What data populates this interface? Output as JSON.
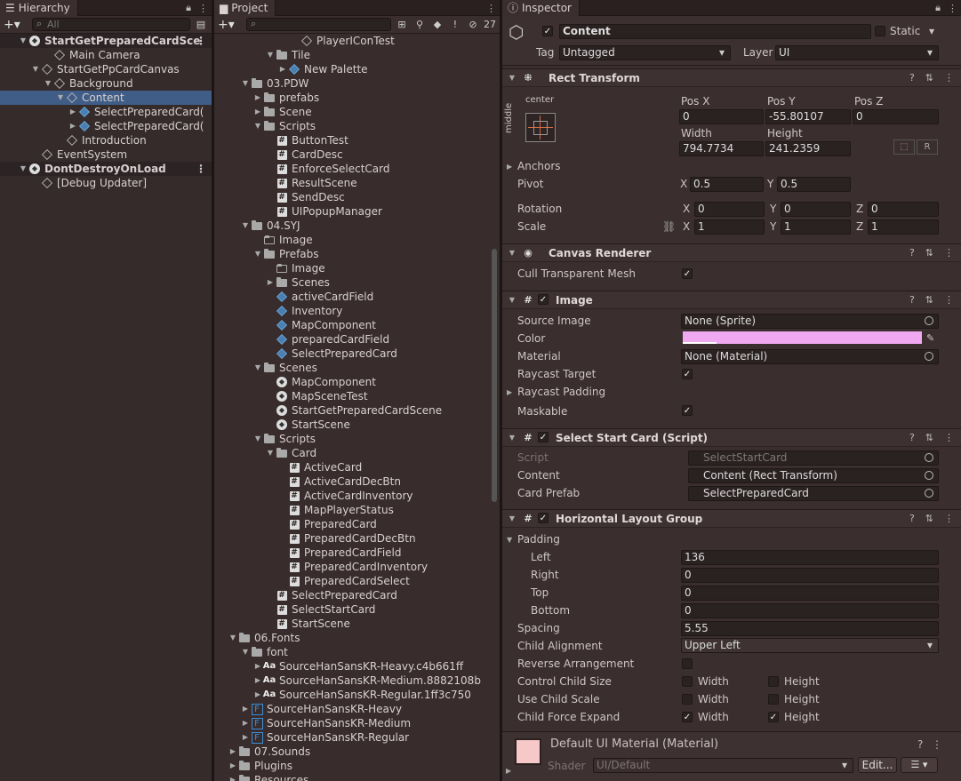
{
  "hierarchy": {
    "tab": "Hierarchy",
    "search_placeholder": "All",
    "rows": [
      {
        "label": "StartGetPreparedCardSce",
        "indent": 0,
        "icon": "unity-scene-icon",
        "arrow": "down",
        "scene": true
      },
      {
        "label": "Main Camera",
        "indent": 2,
        "icon": "gameobject-cube-icon"
      },
      {
        "label": "StartGetPpCardCanvas",
        "indent": 1,
        "icon": "gameobject-cube-icon",
        "arrow": "down"
      },
      {
        "label": "Background",
        "indent": 2,
        "icon": "gameobject-cube-icon",
        "arrow": "down"
      },
      {
        "label": "Content",
        "indent": 3,
        "icon": "gameobject-cube-icon",
        "arrow": "down",
        "selected": true
      },
      {
        "label": "SelectPreparedCard(",
        "indent": 4,
        "icon": "prefab-cube-icon",
        "arrow": "right"
      },
      {
        "label": "SelectPreparedCard(",
        "indent": 4,
        "icon": "prefab-cube-icon",
        "arrow": "right"
      },
      {
        "label": "Introduction",
        "indent": 3,
        "icon": "gameobject-cube-icon"
      },
      {
        "label": "EventSystem",
        "indent": 1,
        "icon": "gameobject-cube-icon"
      },
      {
        "label": "DontDestroyOnLoad",
        "indent": 0,
        "icon": "unity-scene-icon",
        "arrow": "down",
        "scene": true
      },
      {
        "label": "[Debug Updater]",
        "indent": 1,
        "icon": "gameobject-cube-icon"
      }
    ]
  },
  "project": {
    "tab": "Project",
    "hidden_count": "27",
    "rows": [
      {
        "label": "PlayerIConTest",
        "indent": 5,
        "icon": "gameobject-cube-icon"
      },
      {
        "label": "Tile",
        "indent": 3,
        "icon": "folder-icon",
        "arrow": "down"
      },
      {
        "label": "New Palette",
        "indent": 4,
        "icon": "prefab-cube-icon",
        "arrow": "right"
      },
      {
        "label": "03.PDW",
        "indent": 1,
        "icon": "folder-icon",
        "arrow": "down"
      },
      {
        "label": "prefabs",
        "indent": 2,
        "icon": "folder-icon",
        "arrow": "right"
      },
      {
        "label": "Scene",
        "indent": 2,
        "icon": "folder-icon",
        "arrow": "right"
      },
      {
        "label": "Scripts",
        "indent": 2,
        "icon": "folder-icon",
        "arrow": "down"
      },
      {
        "label": "ButtonTest",
        "indent": 3,
        "icon": "script-hash-icon"
      },
      {
        "label": "CardDesc",
        "indent": 3,
        "icon": "script-hash-icon"
      },
      {
        "label": "EnforceSelectCard",
        "indent": 3,
        "icon": "script-hash-icon"
      },
      {
        "label": "ResultScene",
        "indent": 3,
        "icon": "script-hash-icon"
      },
      {
        "label": "SendDesc",
        "indent": 3,
        "icon": "script-hash-icon"
      },
      {
        "label": "UIPopupManager",
        "indent": 3,
        "icon": "script-hash-icon"
      },
      {
        "label": "04.SYJ",
        "indent": 1,
        "icon": "folder-icon",
        "arrow": "down"
      },
      {
        "label": "Image",
        "indent": 2,
        "icon": "empty-folder-icon"
      },
      {
        "label": "Prefabs",
        "indent": 2,
        "icon": "folder-icon",
        "arrow": "down"
      },
      {
        "label": "Image",
        "indent": 3,
        "icon": "empty-folder-icon"
      },
      {
        "label": "Scenes",
        "indent": 3,
        "icon": "folder-icon",
        "arrow": "right"
      },
      {
        "label": "activeCardField",
        "indent": 3,
        "icon": "prefab-cube-icon"
      },
      {
        "label": "Inventory",
        "indent": 3,
        "icon": "prefab-cube-icon"
      },
      {
        "label": "MapComponent",
        "indent": 3,
        "icon": "prefab-cube-icon"
      },
      {
        "label": "preparedCardField",
        "indent": 3,
        "icon": "prefab-cube-icon"
      },
      {
        "label": "SelectPreparedCard",
        "indent": 3,
        "icon": "prefab-cube-icon"
      },
      {
        "label": "Scenes",
        "indent": 2,
        "icon": "folder-icon",
        "arrow": "down"
      },
      {
        "label": "MapComponent",
        "indent": 3,
        "icon": "unity-scene-icon"
      },
      {
        "label": "MapSceneTest",
        "indent": 3,
        "icon": "unity-scene-icon"
      },
      {
        "label": "StartGetPreparedCardScene",
        "indent": 3,
        "icon": "unity-scene-icon"
      },
      {
        "label": "StartScene",
        "indent": 3,
        "icon": "unity-scene-icon"
      },
      {
        "label": "Scripts",
        "indent": 2,
        "icon": "folder-icon",
        "arrow": "down"
      },
      {
        "label": "Card",
        "indent": 3,
        "icon": "folder-icon",
        "arrow": "down"
      },
      {
        "label": "ActiveCard",
        "indent": 4,
        "icon": "script-hash-icon"
      },
      {
        "label": "ActiveCardDecBtn",
        "indent": 4,
        "icon": "script-hash-icon"
      },
      {
        "label": "ActiveCardInventory",
        "indent": 4,
        "icon": "script-hash-icon"
      },
      {
        "label": "MapPlayerStatus",
        "indent": 4,
        "icon": "script-hash-icon"
      },
      {
        "label": "PreparedCard",
        "indent": 4,
        "icon": "script-hash-icon"
      },
      {
        "label": "PreparedCardDecBtn",
        "indent": 4,
        "icon": "script-hash-icon"
      },
      {
        "label": "PreparedCardField",
        "indent": 4,
        "icon": "script-hash-icon"
      },
      {
        "label": "PreparedCardInventory",
        "indent": 4,
        "icon": "script-hash-icon"
      },
      {
        "label": "PreparedCardSelect",
        "indent": 4,
        "icon": "script-hash-icon"
      },
      {
        "label": "SelectPreparedCard",
        "indent": 3,
        "icon": "script-hash-icon"
      },
      {
        "label": "SelectStartCard",
        "indent": 3,
        "icon": "script-hash-icon"
      },
      {
        "label": "StartScene",
        "indent": 3,
        "icon": "script-hash-icon"
      },
      {
        "label": "06.Fonts",
        "indent": 0,
        "icon": "folder-icon",
        "arrow": "down"
      },
      {
        "label": "font",
        "indent": 1,
        "icon": "folder-icon",
        "arrow": "down"
      },
      {
        "label": "SourceHanSansKR-Heavy.c4b661ff",
        "indent": 2,
        "icon": "font-aa-icon",
        "arrow": "right"
      },
      {
        "label": "SourceHanSansKR-Medium.8882108b",
        "indent": 2,
        "icon": "font-aa-icon",
        "arrow": "right"
      },
      {
        "label": "SourceHanSansKR-Regular.1ff3c750",
        "indent": 2,
        "icon": "font-aa-icon",
        "arrow": "right"
      },
      {
        "label": "SourceHanSansKR-Heavy",
        "indent": 1,
        "icon": "font-asset-icon",
        "arrow": "right"
      },
      {
        "label": "SourceHanSansKR-Medium",
        "indent": 1,
        "icon": "font-asset-icon",
        "arrow": "right"
      },
      {
        "label": "SourceHanSansKR-Regular",
        "indent": 1,
        "icon": "font-asset-icon",
        "arrow": "right"
      },
      {
        "label": "07.Sounds",
        "indent": 0,
        "icon": "folder-icon",
        "arrow": "right"
      },
      {
        "label": "Plugins",
        "indent": 0,
        "icon": "folder-icon",
        "arrow": "right"
      },
      {
        "label": "Resources",
        "indent": 0,
        "icon": "folder-icon",
        "arrow": "right"
      }
    ]
  },
  "inspector": {
    "tab": "Inspector",
    "object_name": "Content",
    "static_label": "Static",
    "tag_label": "Tag",
    "tag_value": "Untagged",
    "layer_label": "Layer",
    "layer_value": "UI",
    "rect": {
      "title": "Rect Transform",
      "anchor_top": "center",
      "anchor_side": "middle",
      "posx_label": "Pos X",
      "posy_label": "Pos Y",
      "posz_label": "Pos Z",
      "posx": "0",
      "posy": "-55.80107",
      "posz": "0",
      "width_label": "Width",
      "height_label": "Height",
      "width": "794.7734",
      "height": "241.2359",
      "anchors": "Anchors",
      "pivot": "Pivot",
      "pivot_x": "0.5",
      "pivot_y": "0.5",
      "rotation": "Rotation",
      "rot_x": "0",
      "rot_y": "0",
      "rot_z": "0",
      "scale": "Scale",
      "scale_x": "1",
      "scale_y": "1",
      "scale_z": "1",
      "x": "X",
      "y": "Y",
      "z": "Z",
      "r_btn": "R"
    },
    "canvas_renderer": {
      "title": "Canvas Renderer",
      "cull": "Cull Transparent Mesh"
    },
    "image": {
      "title": "Image",
      "source_label": "Source Image",
      "source": "None (Sprite)",
      "color_label": "Color",
      "color": "#f0a8f0",
      "material_label": "Material",
      "material": "None (Material)",
      "raycast_target": "Raycast Target",
      "raycast_padding": "Raycast Padding",
      "maskable": "Maskable"
    },
    "script": {
      "title": "Select Start Card (Script)",
      "script_label": "Script",
      "script_value": "SelectStartCard",
      "content_label": "Content",
      "content_value": "Content (Rect Transform)",
      "prefab_label": "Card Prefab",
      "prefab_value": "SelectPreparedCard"
    },
    "hlg": {
      "title": "Horizontal Layout Group",
      "padding": "Padding",
      "left_label": "Left",
      "left": "136",
      "right_label": "Right",
      "right": "0",
      "top_label": "Top",
      "top": "0",
      "bottom_label": "Bottom",
      "bottom": "0",
      "spacing_label": "Spacing",
      "spacing": "5.55",
      "align_label": "Child Alignment",
      "align": "Upper Left",
      "reverse": "Reverse Arrangement",
      "control_size": "Control Child Size",
      "use_scale": "Use Child Scale",
      "force_expand": "Child Force Expand",
      "width": "Width",
      "height": "Height"
    },
    "material": {
      "title": "Default UI Material (Material)",
      "shader_label": "Shader",
      "shader": "UI/Default",
      "edit": "Edit...",
      "swatch_color": "#f7c8c8"
    }
  },
  "colors": {
    "selection": "#3f5d86",
    "panel": "#382c2c"
  }
}
